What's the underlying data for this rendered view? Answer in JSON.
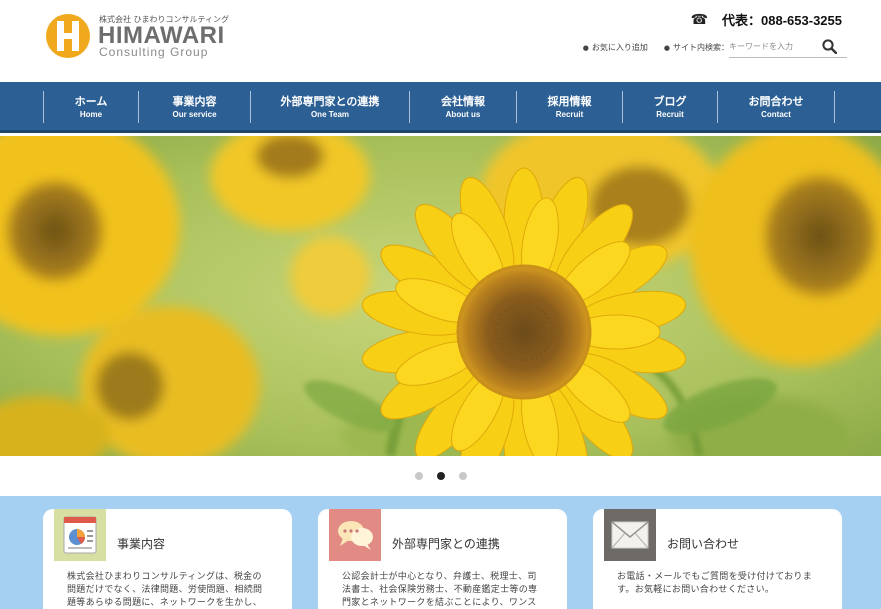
{
  "header": {
    "company_small": "株式会社 ひまわりコンサルティング",
    "brand": "HIMAWARI",
    "brand_tag": "Consulting Group",
    "phone_icon": "phone-icon",
    "phone_text": "代表：088-653-3255",
    "favorite_link": "お気に入り追加",
    "search_label": "サイト内検索：",
    "search_placeholder": "キーワードを入力",
    "search_value": ""
  },
  "nav": {
    "items": [
      {
        "jp": "ホーム",
        "en": "Home"
      },
      {
        "jp": "事業内容",
        "en": "Our service"
      },
      {
        "jp": "外部専門家との連携",
        "en": "One Team"
      },
      {
        "jp": "会社情報",
        "en": "About us"
      },
      {
        "jp": "採用情報",
        "en": "Recruit"
      },
      {
        "jp": "ブログ",
        "en": "Recruit"
      },
      {
        "jp": "お問合わせ",
        "en": "Contact"
      }
    ]
  },
  "slider": {
    "count": 3,
    "active": 2
  },
  "cards": [
    {
      "title": "事業内容",
      "icon": "chart-document-icon",
      "body": "株式会社ひまわりコンサルティングは、税金の問題だけでなく、法律問題、労使問題、相続問題等あらゆる問題に、ネットワークを生かし、それぞれの専門家が対応す"
    },
    {
      "title": "外部専門家との連携",
      "icon": "speech-bubbles-icon",
      "body": "公認会計士が中心となり、弁護士、税理士、司法書士、社会保険労務士、不動産鑑定士等の専門家とネットワークを結ぶことにより、ワンストップショップを目指す事"
    },
    {
      "title": "お問い合わせ",
      "icon": "envelope-icon",
      "body": "お電話・メールでもご質問を受け付けております。お気軽にお問い合わせください。"
    }
  ],
  "colors": {
    "nav": "#2c5f94",
    "cards_bg": "#a6d0f2",
    "logo_orange": "#f0a81c"
  }
}
